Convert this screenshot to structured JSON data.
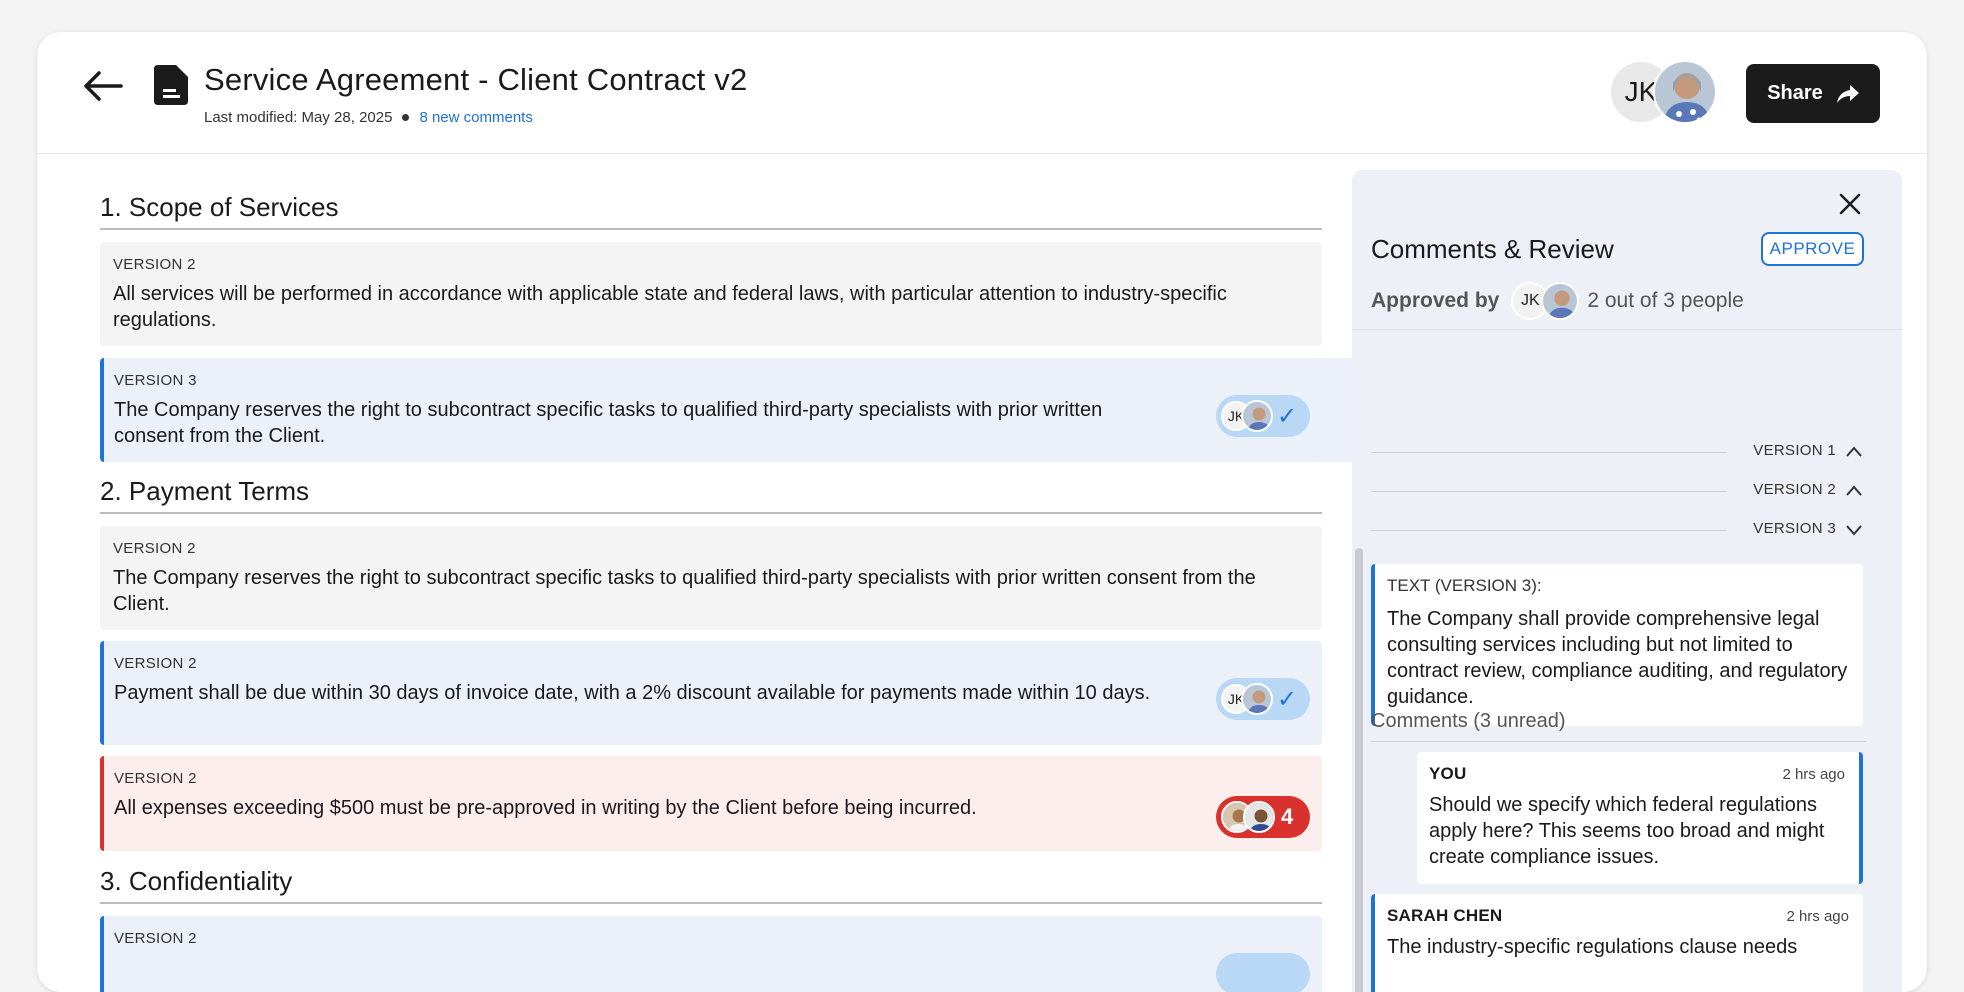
{
  "header": {
    "title": "Service Agreement - Client Contract v2",
    "last_modified": "Last modified: May 28, 2025",
    "new_comments": "8 new comments",
    "collaborator_initials": "JK",
    "share_label": "Share"
  },
  "document": {
    "sections": [
      {
        "title": "1. Scope of Services"
      },
      {
        "title": "2. Payment Terms"
      },
      {
        "title": "3. Confidentiality"
      }
    ],
    "cards": [
      {
        "version": "VERSION 2",
        "text": "All services will be performed in accordance with applicable state and federal laws, with particular attention to industry-specific regulations."
      },
      {
        "version": "VERSION 3",
        "text": "The Company reserves the right to subcontract specific tasks to qualified third-party specialists with prior written consent from the Client.",
        "initials": "JK",
        "status": "approved"
      },
      {
        "version": "VERSION 2",
        "text": "The Company reserves the right to subcontract specific tasks to qualified third-party specialists with prior written consent from the Client."
      },
      {
        "version": "VERSION 2",
        "text": "Payment shall be due within 30 days of invoice date, with a 2% discount available for payments made within 10 days.",
        "initials": "JK",
        "status": "approved"
      },
      {
        "version": "VERSION 2",
        "text": "All expenses exceeding $500 must be pre-approved in writing by the Client before being incurred.",
        "comment_count": "4",
        "status": "flagged"
      },
      {
        "version": "VERSION 2",
        "text": ""
      }
    ]
  },
  "panel": {
    "title": "Comments & Review",
    "approve_label": "APPROVE",
    "approved_by_label": "Approved by",
    "approver_initials": "JK",
    "approved_count": "2 out of 3 people",
    "versions": [
      {
        "label": "VERSION 1",
        "state": "expanded"
      },
      {
        "label": "VERSION 2",
        "state": "expanded"
      },
      {
        "label": "VERSION 3",
        "state": "collapsed"
      }
    ],
    "text_header": "TEXT (VERSION 3):",
    "text_body": "The Company shall provide comprehensive legal consulting services including but not limited to contract review, compliance auditing, and regulatory guidance.",
    "comments_header": "Comments (3 unread)",
    "comments": [
      {
        "author": "YOU",
        "time": "2 hrs ago",
        "body": "Should we specify which federal regulations apply here? This seems too broad and might create compliance issues."
      },
      {
        "author": "SARAH CHEN",
        "time": "2 hrs ago",
        "body": "The industry-specific regulations clause needs"
      }
    ]
  },
  "colors": {
    "accent": "#1f73d6",
    "alert": "#d9322e",
    "share_bg": "#1b1b1b"
  }
}
